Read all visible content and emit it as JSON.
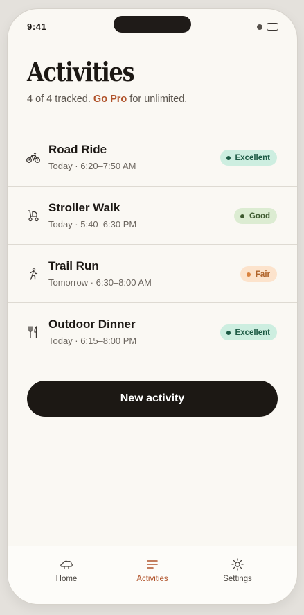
{
  "status_bar": {
    "time": "9:41"
  },
  "header": {
    "title": "Activities",
    "subtitle_prefix": "4 of 4 tracked.",
    "subtitle_link": "Go Pro",
    "subtitle_suffix": "for unlimited."
  },
  "activities": [
    {
      "icon": "bicycle-icon",
      "title": "Road Ride",
      "time": "Today · 6:20–7:50 AM",
      "rating": "Excellent"
    },
    {
      "icon": "stroller-icon",
      "title": "Stroller Walk",
      "time": "Today · 5:40–6:30 PM",
      "rating": "Good"
    },
    {
      "icon": "runner-icon",
      "title": "Trail Run",
      "time": "Tomorrow · 6:30–8:00 AM",
      "rating": "Fair"
    },
    {
      "icon": "fork-knife-icon",
      "title": "Outdoor Dinner",
      "time": "Today · 6:15–8:00 PM",
      "rating": "Excellent"
    }
  ],
  "new_activity_button": "New activity",
  "tabs": [
    {
      "icon": "home-cloud-icon",
      "label": "Home",
      "active": false
    },
    {
      "icon": "list-icon",
      "label": "Activities",
      "active": true
    },
    {
      "icon": "sun-gear-icon",
      "label": "Settings",
      "active": false
    }
  ],
  "colors": {
    "background": "#faf8f3",
    "accent": "#b0532b",
    "primary_button": "#1c1814",
    "excellent_bg": "#cdeee0",
    "good_bg": "#dcecd2",
    "fair_bg": "#fce3cc"
  }
}
